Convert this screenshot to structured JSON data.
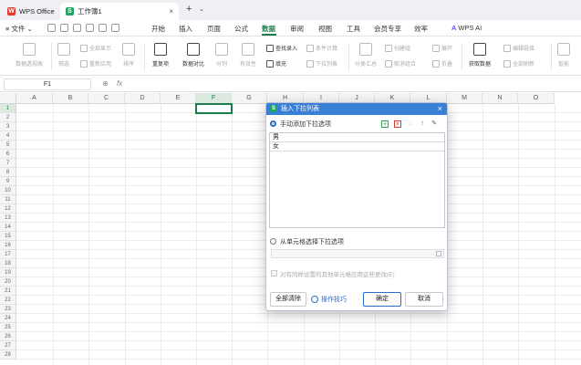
{
  "titlebar": {
    "app_tab": "WPS Office",
    "app_logo": "W",
    "doc_tab": "工作簿1",
    "doc_logo": "S",
    "close": "×",
    "new_tab": "+",
    "new_tab_menu": "⌄"
  },
  "menubar": {
    "file": "文件",
    "items": [
      "开始",
      "插入",
      "页面",
      "公式",
      "数据",
      "审阅",
      "视图",
      "工具",
      "会员专享",
      "效率"
    ],
    "active": "数据",
    "ai": "WPS AI"
  },
  "ribbon": {
    "buttons": {
      "pivot": "数据透视表",
      "filter": "筛选",
      "sort": "排序",
      "dup": "重复项",
      "compare": "数据对比",
      "split": "分列",
      "validity": "有效性",
      "dropdown": "下拉列表",
      "consolidate": "合并计算",
      "subtotal": "分类汇总",
      "group": "取消组合",
      "fold": "折叠",
      "getdata": "获取数据",
      "refresh": "全部刷新",
      "reverse": "智能"
    },
    "smalls": {
      "show_all": "全部显示",
      "reapply": "重新应用",
      "find_entry": "查找录入",
      "fill": "填充",
      "cond_calc": "条件计算",
      "dropdown_list": "下拉列表",
      "create_group": "创建组",
      "ungroup": "取消组合",
      "expand": "展开",
      "edit_links": "编辑链接",
      "refresh_all": "全部刷新"
    }
  },
  "formula": {
    "namebox": "F1",
    "fx": "fx",
    "zoom_icon": "⊕"
  },
  "grid": {
    "columns": [
      "A",
      "B",
      "C",
      "D",
      "E",
      "F",
      "G",
      "H",
      "I",
      "J",
      "K",
      "L",
      "M",
      "N",
      "O"
    ],
    "selected_col": "F",
    "rows": [
      "1",
      "2",
      "3",
      "4",
      "5",
      "6",
      "7",
      "8",
      "9",
      "10",
      "11",
      "12",
      "13",
      "14",
      "15",
      "16",
      "17",
      "18",
      "19",
      "20",
      "21",
      "22",
      "23",
      "24",
      "25",
      "26",
      "27",
      "28"
    ],
    "selected_row": "1"
  },
  "dialog": {
    "title": "插入下拉列表",
    "logo": "S",
    "close": "×",
    "manual_option": "手动添加下拉选项",
    "items": [
      "男",
      "女"
    ],
    "range_option": "从单元格选择下拉选项",
    "apply_label": "对有同样设置的其他单元格应用这些更改(E)",
    "clear_all": "全部清除",
    "tips": "操作技巧",
    "ok": "确定",
    "cancel": "取消"
  }
}
